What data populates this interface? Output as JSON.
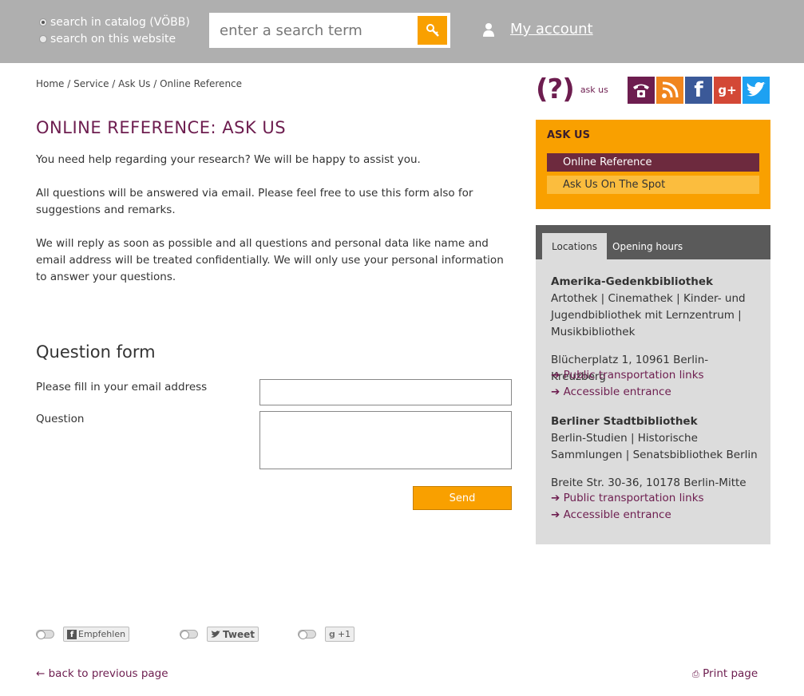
{
  "header": {
    "search_options": [
      {
        "label": "search in catalog (VÖBB)",
        "selected": true
      },
      {
        "label": "search on this website",
        "selected": false
      }
    ],
    "search_placeholder": "enter a search term",
    "account_label": "My account"
  },
  "breadcrumb": [
    "Home",
    "Service",
    "Ask Us",
    "Online Reference"
  ],
  "main": {
    "title": "ONLINE REFERENCE: ASK US",
    "paragraphs": [
      "You need help regarding your research? We will be happy to assist you.",
      "All questions will be answered via email. Please feel free to use this form also for suggestions and remarks.",
      "We will reply as soon as possible and all questions and personal data like name and email address will be treated confidentially. We will only use your personal information to answer your questions."
    ],
    "form_title": "Question form",
    "email_label": "Please fill in your email address",
    "question_label": "Question",
    "send_label": "Send"
  },
  "share": {
    "facebook_label": "Empfehlen",
    "twitter_label": "Tweet",
    "gplus_label": "+1"
  },
  "footer": {
    "back_label": "back to previous page",
    "print_label": "Print page"
  },
  "sidebar": {
    "logo_symbol": "(?)",
    "logo_text": "ask us",
    "social_icons": [
      "phone-icon",
      "rss-icon",
      "facebook-icon",
      "google-plus-icon",
      "twitter-icon"
    ],
    "ask_us": {
      "title": "ASK US",
      "items": [
        {
          "label": "Online Reference",
          "active": true
        },
        {
          "label": "Ask Us On The Spot",
          "active": false
        }
      ]
    },
    "tabs": [
      {
        "label": "Locations",
        "active": true
      },
      {
        "label": "Opening hours",
        "active": false
      }
    ],
    "locations": [
      {
        "name": "Amerika-Gedenkbibliothek",
        "departments": "Artothek | Cinemathek | Kinder- und Jugendbibliothek mit Lernzentrum | Musikbibliothek",
        "address": "Blücherplatz 1, 10961 Berlin-Kreuzberg",
        "transport_link": "Public transportation links",
        "access_link": "Accessible entrance"
      },
      {
        "name": "Berliner Stadtbibliothek",
        "departments": "Berlin-Studien |  Historische Sammlungen | Senatsbibliothek Berlin",
        "address": "Breite Str. 30-36, 10178 Berlin-Mitte",
        "transport_link": "Public transportation links",
        "access_link": "Accessible entrance"
      }
    ]
  },
  "colors": {
    "header_bg": "#afafaf",
    "accent_orange": "#f9a000",
    "brand_purple": "#6d1d4f",
    "active_item": "#6d2a3e"
  }
}
